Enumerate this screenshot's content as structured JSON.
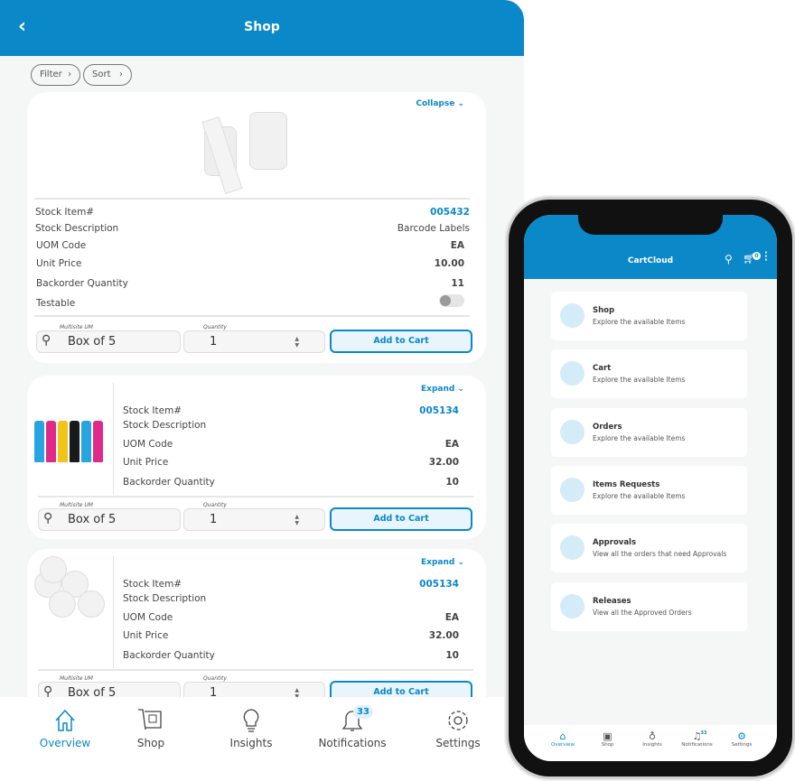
{
  "header": {
    "title": "Shop",
    "back_icon": "chevron-left-icon"
  },
  "filters": {
    "filter": "Filter",
    "sort": "Sort"
  },
  "labels": {
    "stock_item": "Stock Item#",
    "stock_description": "Stock Description",
    "uom_code": "UOM Code",
    "unit_price": "Unit Price",
    "backorder_quantity": "Backorder Quantity",
    "testable": "Testable",
    "multisite_um": "Multisite UM",
    "quantity": "Quantity",
    "add_to_cart": "Add to Cart"
  },
  "products": [
    {
      "toggle": "Collapse",
      "stock_item": "005432",
      "description": "Barcode Labels",
      "uom": "EA",
      "unit_price": "10.00",
      "backorder": "11",
      "testable": false,
      "um": "Box of 5",
      "quantity": "1"
    },
    {
      "toggle": "Expand",
      "stock_item": "005134",
      "description": "",
      "uom": "EA",
      "unit_price": "32.00",
      "backorder": "10",
      "um": "Box of 5",
      "quantity": "1"
    },
    {
      "toggle": "Expand",
      "stock_item": "005134",
      "description": "",
      "uom": "EA",
      "unit_price": "32.00",
      "backorder": "10",
      "um": "Box of 5",
      "quantity": "1"
    }
  ],
  "nav": {
    "items": [
      {
        "label": "Overview",
        "icon": "home-icon",
        "active": true
      },
      {
        "label": "Shop",
        "icon": "shop-icon"
      },
      {
        "label": "Insights",
        "icon": "lightbulb-icon"
      },
      {
        "label": "Notifications",
        "icon": "bell-icon",
        "badge": "33"
      },
      {
        "label": "Settings",
        "icon": "gear-icon"
      }
    ]
  },
  "phone": {
    "title": "CartCloud",
    "cart_badge": "0",
    "menu": [
      {
        "title": "Shop",
        "subtitle": "Explore the available Items"
      },
      {
        "title": "Cart",
        "subtitle": "Explore the available Items"
      },
      {
        "title": "Orders",
        "subtitle": "Explore the available Items"
      },
      {
        "title": "Items Requests",
        "subtitle": "Explore the available Items"
      },
      {
        "title": "Approvals",
        "subtitle": "View all the orders that need Approvals"
      },
      {
        "title": "Releases",
        "subtitle": "View all the Approved Orders"
      }
    ]
  },
  "colors": {
    "accent": "#0a88c8",
    "background": "#f5f6f6"
  }
}
